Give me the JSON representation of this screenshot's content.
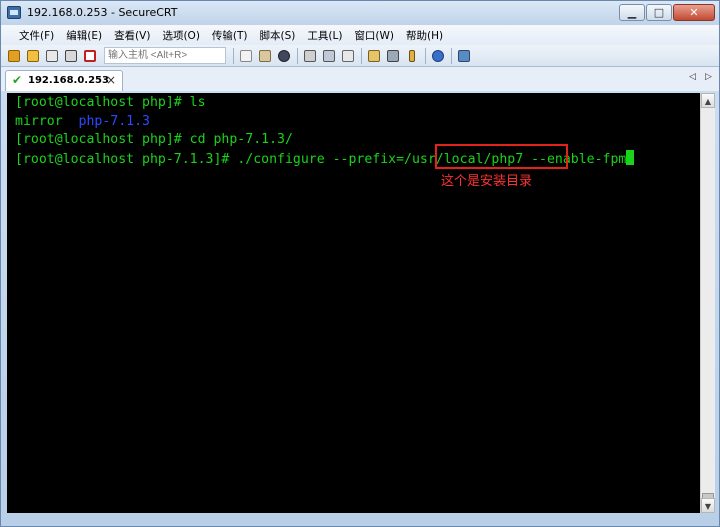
{
  "window": {
    "title": "192.168.0.253 - SecureCRT",
    "buttons": {
      "minimize": "▁",
      "maximize": "□",
      "close": "✕"
    }
  },
  "menu": [
    "文件(F)",
    "编辑(E)",
    "查看(V)",
    "选项(O)",
    "传输(T)",
    "脚本(S)",
    "工具(L)",
    "窗口(W)",
    "帮助(H)"
  ],
  "toolbar": {
    "quick_connect_placeholder": "输入主机 <Alt+R>",
    "icons": [
      "connect-icon",
      "quick-connect-icon",
      "connect-tab-icon",
      "reconnect-icon",
      "disconnect-icon",
      "copy-icon",
      "paste-icon",
      "find-icon",
      "print-icon",
      "print-setup-icon",
      "log-icon",
      "session-options-icon",
      "global-options-icon",
      "keymap-icon",
      "help-icon",
      "sftp-icon"
    ]
  },
  "tabs": [
    {
      "label": "192.168.0.253",
      "close": "×",
      "status": "connected"
    }
  ],
  "tab_nav": {
    "prev": "◁",
    "next": "▷"
  },
  "terminal": {
    "lines": [
      {
        "prompt": "[root@localhost php]# ",
        "command": "ls"
      },
      {
        "col1": "mirror  ",
        "col2": "php-7.1.3"
      },
      {
        "prompt": "[root@localhost php]# ",
        "command": "cd php-7.1.3/"
      },
      {
        "prompt": "[root@localhost php-7.1.3]# ",
        "command_pre": "./configure --prefix=",
        "command_hl": "/usr/local/php7",
        "command_post": " --enable-fpm"
      }
    ],
    "annotation": "这个是安装目录"
  },
  "colors": {
    "terminal_bg": "#000000",
    "terminal_text": "#19d419",
    "directory_listing": "#2a4bff",
    "annotation": "#ff3030",
    "highlight_border": "#e0231b"
  }
}
